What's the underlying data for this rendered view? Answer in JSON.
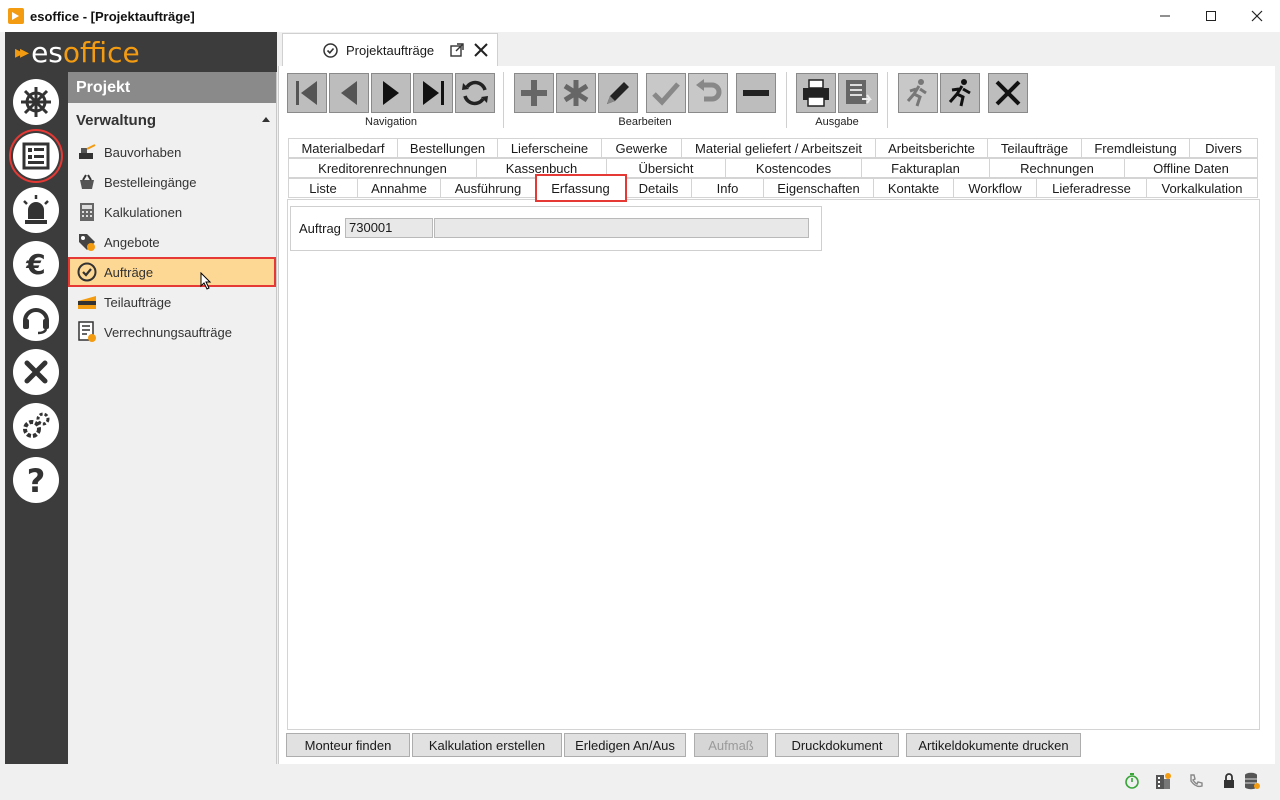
{
  "window": {
    "title": "esoffice - [Projektaufträge]"
  },
  "logo": {
    "part1": "es",
    "part2": "office"
  },
  "rail": {
    "items": [
      "helm-icon",
      "project-icon",
      "alarm-light-icon",
      "euro-icon",
      "headset-icon",
      "tools-icon",
      "gears-icon",
      "help-icon"
    ]
  },
  "nav": {
    "header": "Projekt",
    "group": "Verwaltung",
    "items": [
      {
        "label": "Bauvorhaben"
      },
      {
        "label": "Bestelleingänge"
      },
      {
        "label": "Kalkulationen"
      },
      {
        "label": "Angebote"
      },
      {
        "label": "Aufträge"
      },
      {
        "label": "Teilaufträge"
      },
      {
        "label": "Verrechnungsaufträge"
      }
    ]
  },
  "doc_tab": {
    "label": "Projektaufträge"
  },
  "toolbar": {
    "groups": [
      {
        "label": "Navigation"
      },
      {
        "label": "Bearbeiten"
      },
      {
        "label": "Ausgabe"
      }
    ]
  },
  "tabs": {
    "row1": [
      "Materialbedarf",
      "Bestellungen",
      "Lieferscheine",
      "Gewerke",
      "Material geliefert / Arbeitszeit",
      "Arbeitsberichte",
      "Teilaufträge",
      "Fremdleistung",
      "Divers"
    ],
    "row2": [
      "Kreditorenrechnungen",
      "Kassenbuch",
      "Übersicht",
      "Kostencodes",
      "Fakturaplan",
      "Rechnungen",
      "Offline Daten"
    ],
    "row3": [
      "Liste",
      "Annahme",
      "Ausführung",
      "Erfassung",
      "Details",
      "Info",
      "Eigenschaften",
      "Kontakte",
      "Workflow",
      "Lieferadresse",
      "Vorkalkulation"
    ],
    "active": "Erfassung"
  },
  "form": {
    "auftrag_label": "Auftrag",
    "auftrag_value": "730001",
    "auftrag_desc": ""
  },
  "bottom_buttons": [
    {
      "label": "Monteur finden"
    },
    {
      "label": "Kalkulation erstellen"
    },
    {
      "label": "Erledigen An/Aus"
    },
    {
      "label": "Aufmaß"
    },
    {
      "label": "Druckdokument"
    },
    {
      "label": "Artikeldokumente drucken"
    }
  ],
  "colors": {
    "accent": "#f39c12",
    "highlight": "#fdd794",
    "selection_border": "#e53935",
    "rail": "#3c3c3c"
  }
}
